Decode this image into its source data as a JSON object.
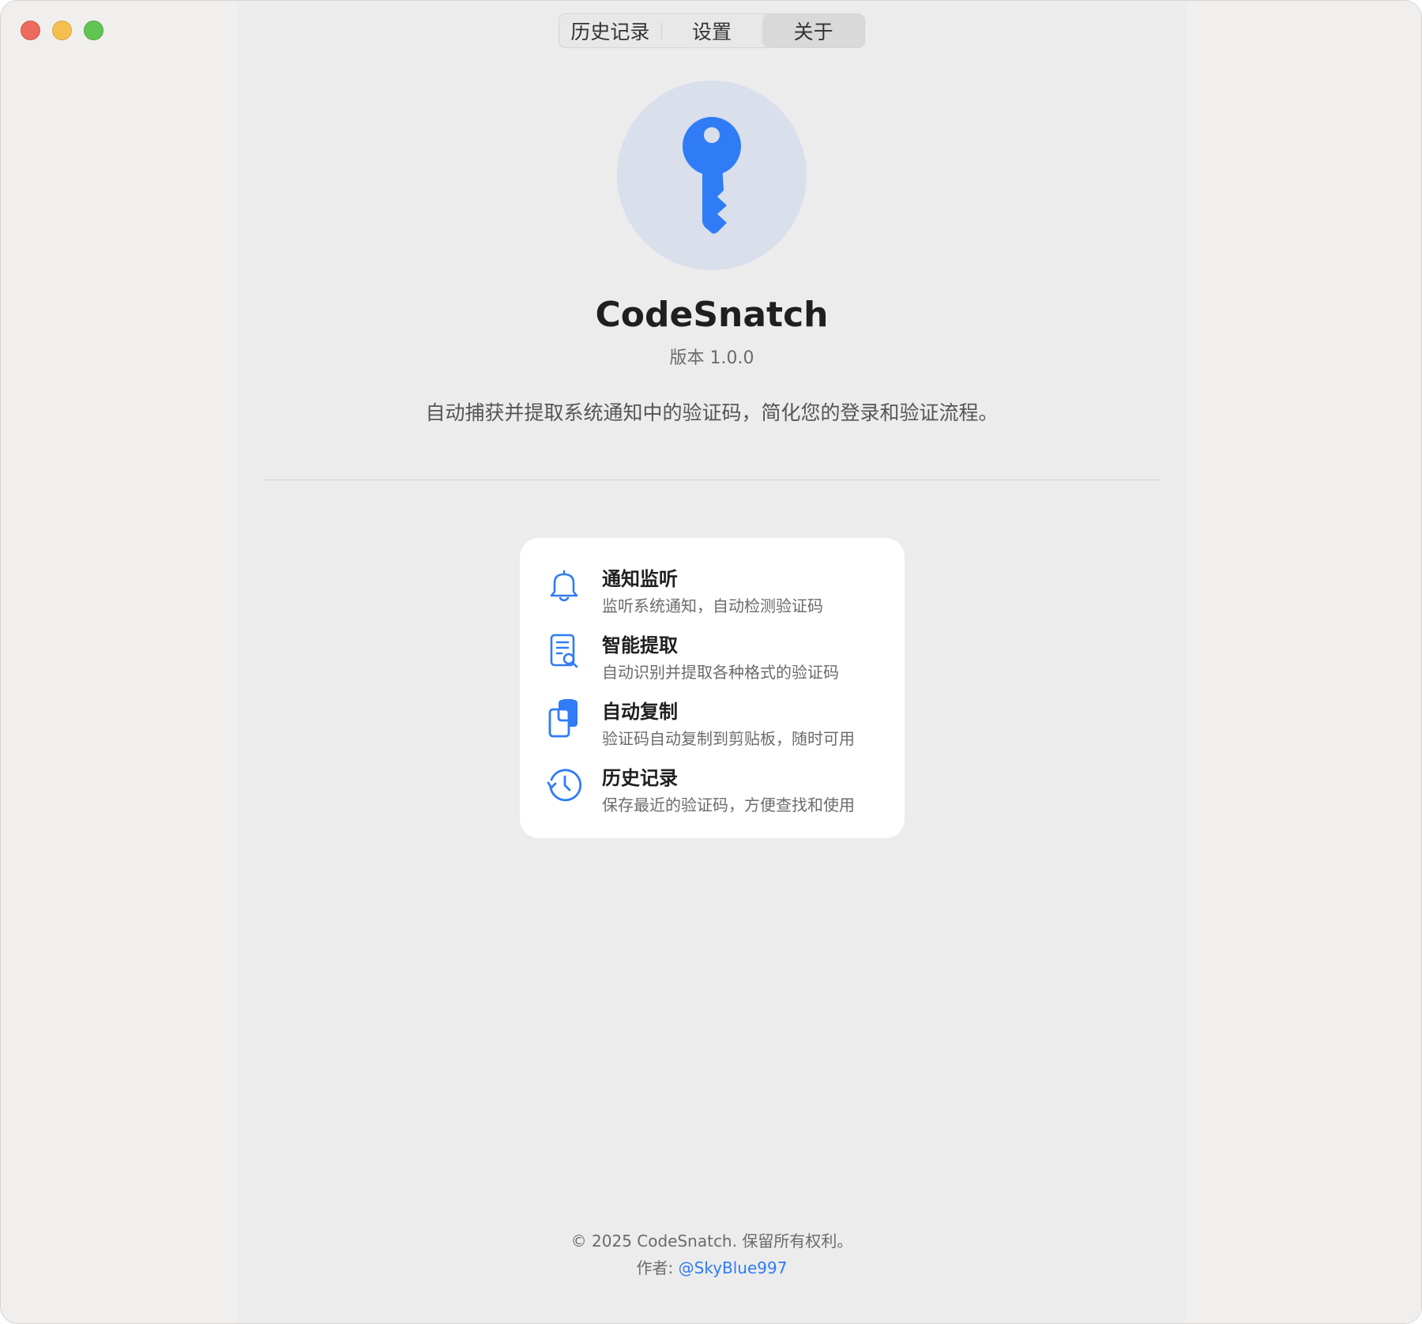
{
  "window": {
    "traffic_lights": [
      "close",
      "minimize",
      "zoom"
    ]
  },
  "tabs": [
    {
      "label": "历史记录",
      "active": false
    },
    {
      "label": "设置",
      "active": false
    },
    {
      "label": "关于",
      "active": true
    }
  ],
  "about": {
    "app_icon": "key-icon",
    "app_name": "CodeSnatch",
    "version": "版本 1.0.0",
    "description": "自动捕获并提取系统通知中的验证码，简化您的登录和验证流程。"
  },
  "features": [
    {
      "icon": "bell-icon",
      "title": "通知监听",
      "desc": "监听系统通知，自动检测验证码"
    },
    {
      "icon": "doc-search-icon",
      "title": "智能提取",
      "desc": "自动识别并提取各种格式的验证码"
    },
    {
      "icon": "copy-icon",
      "title": "自动复制",
      "desc": "验证码自动复制到剪贴板，随时可用"
    },
    {
      "icon": "history-icon",
      "title": "历史记录",
      "desc": "保存最近的验证码，方便查找和使用"
    }
  ],
  "footer": {
    "copyright": "© 2025 CodeSnatch. 保留所有权利。",
    "author_label": "作者: ",
    "author_handle": "@SkyBlue997"
  },
  "colors": {
    "accent": "#2f7cf6",
    "icon_bg": "#d9dfeb",
    "close": "#ec6a5e",
    "minimize": "#f4bf4f",
    "zoom": "#61c554"
  }
}
